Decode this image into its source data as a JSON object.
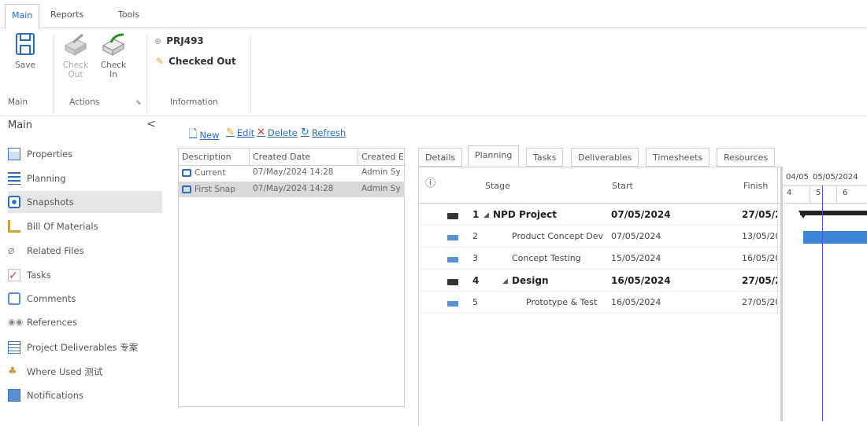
{
  "top_tabs": [
    "Main",
    "Reports",
    "Tools"
  ],
  "ribbon": {
    "save": "Save",
    "check_out": [
      "Check",
      "Out"
    ],
    "check_in": [
      "Check",
      "In"
    ],
    "project_code": "PRJ493",
    "status": "Checked Out",
    "groups": {
      "main": "Main",
      "actions": "Actions",
      "information": "Information"
    }
  },
  "sidebar": {
    "title": "Main",
    "collapse": "<",
    "items": [
      {
        "label": "Properties",
        "icon": "properties-icon"
      },
      {
        "label": "Planning",
        "icon": "planning-icon"
      },
      {
        "label": "Snapshots",
        "icon": "snapshots-icon"
      },
      {
        "label": "Bill Of Materials",
        "icon": "bom-icon"
      },
      {
        "label": "Related Files",
        "icon": "related-files-icon"
      },
      {
        "label": "Tasks",
        "icon": "tasks-icon"
      },
      {
        "label": "Comments",
        "icon": "comments-icon"
      },
      {
        "label": "References",
        "icon": "references-icon"
      },
      {
        "label": "Project Deliverables 专案",
        "icon": "deliverables-icon"
      },
      {
        "label": "Where Used 测试",
        "icon": "where-used-icon"
      },
      {
        "label": "Notifications",
        "icon": "notifications-icon"
      }
    ],
    "active_index": 2
  },
  "snapshots_toolbar": {
    "new": "New",
    "edit": "Edit",
    "delete": "Delete",
    "refresh": "Refresh"
  },
  "snapshots_grid": {
    "headers": [
      "Description",
      "Created Date",
      "Created E"
    ],
    "rows": [
      {
        "description": "Current",
        "created_date": "07/May/2024 14:28",
        "created_by": "Admin Sy"
      },
      {
        "description": "First Snap",
        "created_date": "07/May/2024 14:28",
        "created_by": "Admin Sy"
      }
    ]
  },
  "detail_tabs": [
    "Details",
    "Planning",
    "Tasks",
    "Deliverables",
    "Timesheets",
    "Resources"
  ],
  "detail_active_tab": "Planning",
  "plan_table": {
    "headers": {
      "info": "ⓘ",
      "stage": "Stage",
      "start": "Start",
      "finish": "Finish"
    },
    "rows": [
      {
        "num": "1",
        "stage": "NPD Project",
        "start": "07/05/2024",
        "finish": "27/05/2",
        "summary": true,
        "expander": "◢",
        "indent": 0
      },
      {
        "num": "2",
        "stage": "Product Concept Dev",
        "start": "07/05/2024",
        "finish": "13/05/20",
        "summary": false,
        "expander": "",
        "indent": 1
      },
      {
        "num": "3",
        "stage": "Concept Testing",
        "start": "15/05/2024",
        "finish": "16/05/20",
        "summary": false,
        "expander": "",
        "indent": 1
      },
      {
        "num": "4",
        "stage": "Design",
        "start": "16/05/2024",
        "finish": "27/05/2",
        "summary": true,
        "expander": "◢",
        "indent": 1
      },
      {
        "num": "5",
        "stage": "Prototype & Test",
        "start": "16/05/2024",
        "finish": "27/05/20",
        "summary": false,
        "expander": "",
        "indent": 2
      }
    ]
  },
  "gantt": {
    "dates": [
      "04/05",
      "05/05/2024"
    ],
    "days": [
      "4",
      "5",
      "6"
    ]
  },
  "colors": {
    "accent": "#2a6ebb",
    "task_bar": "#3d86d6",
    "today_line": "#5b4fd9"
  }
}
